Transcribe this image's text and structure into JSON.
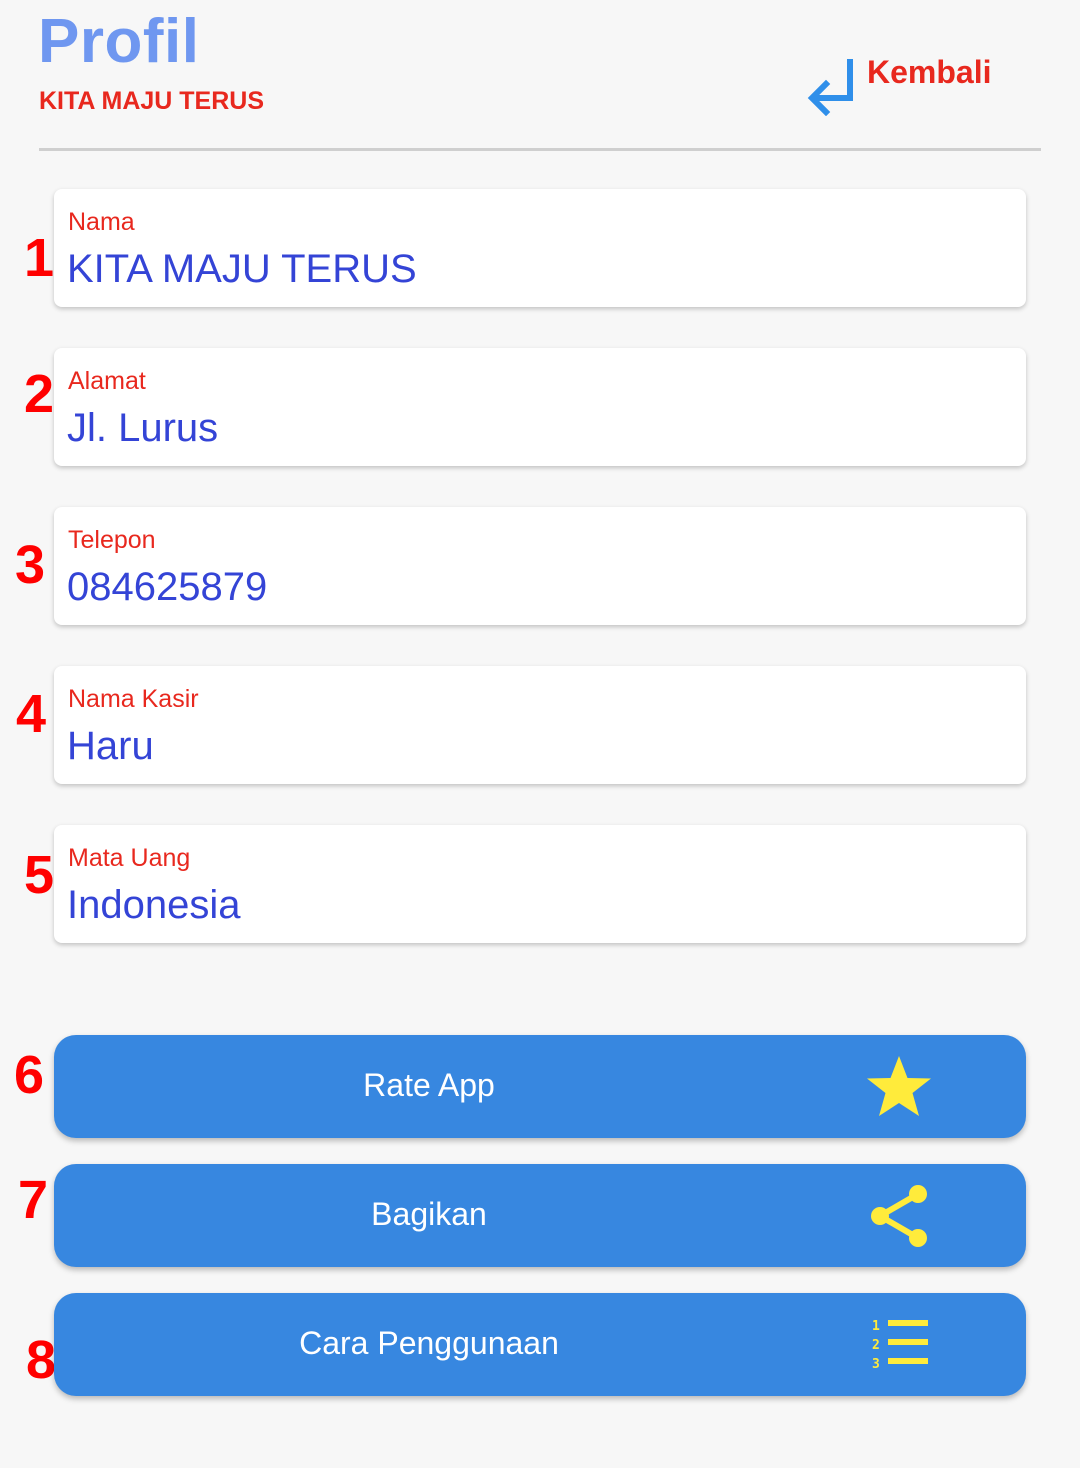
{
  "header": {
    "title": "Profil",
    "subtitle": "KITA MAJU TERUS",
    "back_label": "Kembali"
  },
  "fields": [
    {
      "number": "1",
      "label": "Nama",
      "value": "KITA MAJU TERUS"
    },
    {
      "number": "2",
      "label": "Alamat",
      "value": "Jl. Lurus"
    },
    {
      "number": "3",
      "label": "Telepon",
      "value": "084625879"
    },
    {
      "number": "4",
      "label": "Nama Kasir",
      "value": "Haru"
    },
    {
      "number": "5",
      "label": "Mata Uang",
      "value": "Indonesia"
    }
  ],
  "actions": [
    {
      "number": "6",
      "label": "Rate App",
      "icon": "star-icon"
    },
    {
      "number": "7",
      "label": "Bagikan",
      "icon": "share-icon"
    },
    {
      "number": "8",
      "label": "Cara Penggunaan",
      "icon": "numbered-list-icon"
    }
  ],
  "colors": {
    "title": "#6f97f0",
    "accent_red": "#e8281e",
    "value_blue": "#3444d6",
    "button_blue": "#3787e0",
    "icon_yellow": "#ffeb3b",
    "annotation_red": "#ff0000"
  }
}
